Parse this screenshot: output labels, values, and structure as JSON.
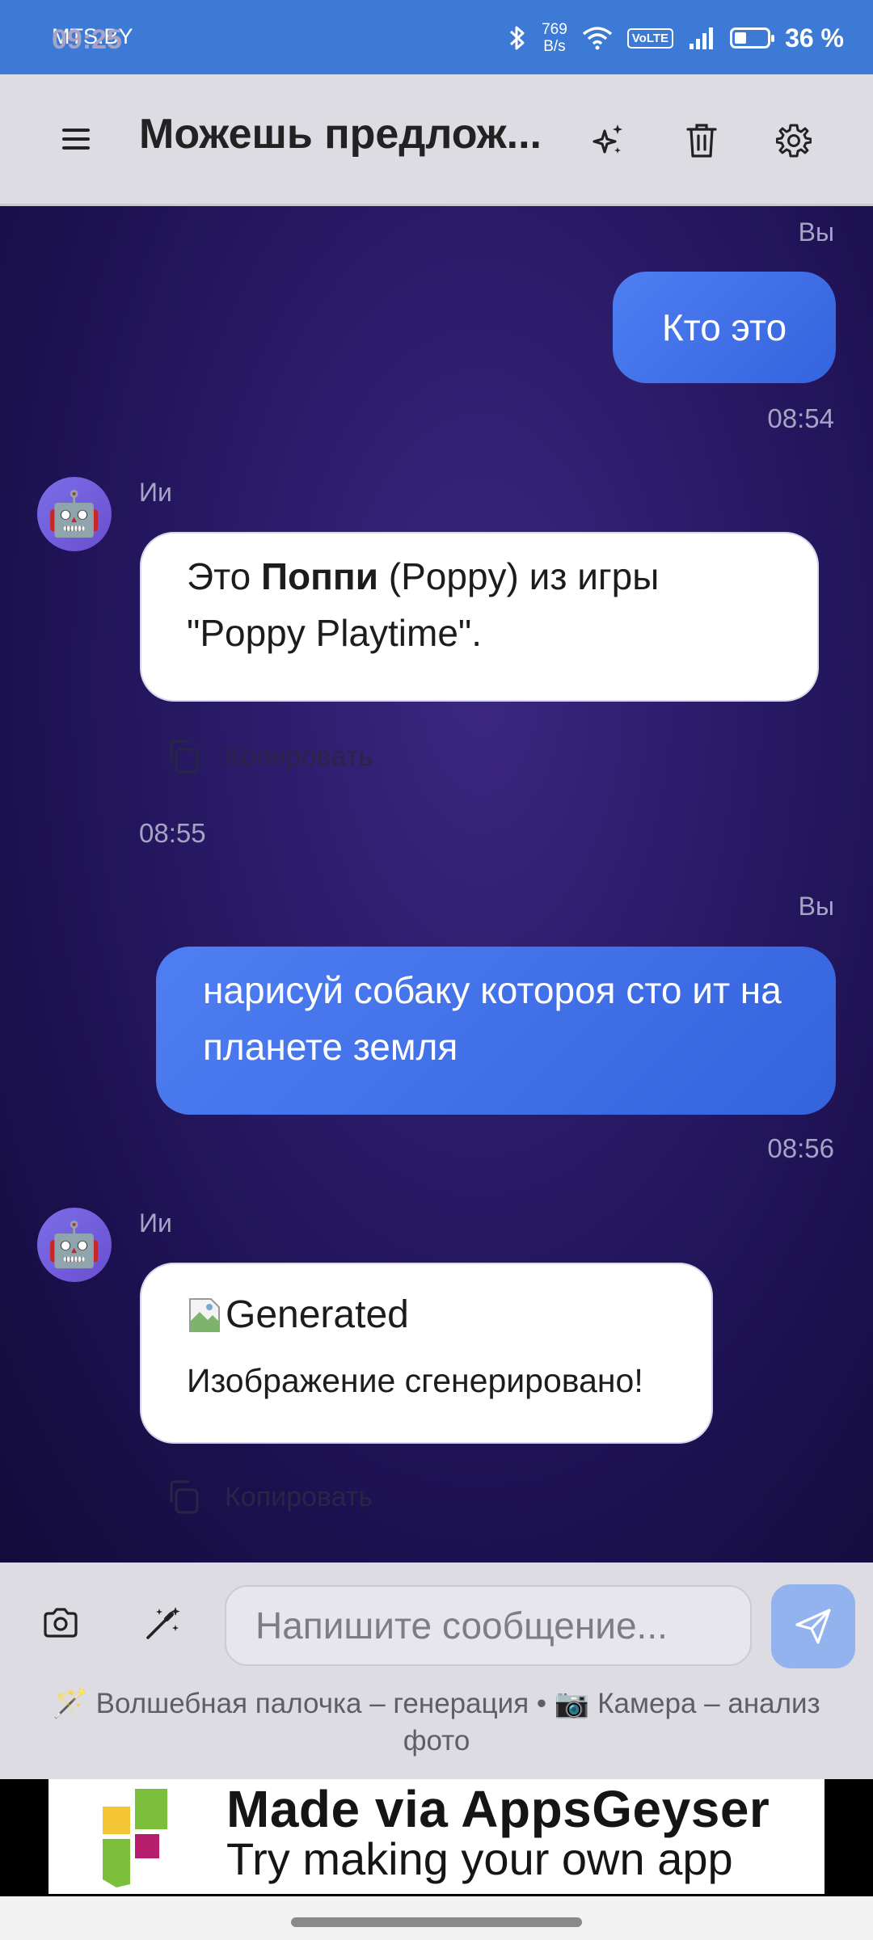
{
  "status_bar": {
    "carrier": "MTS.BY",
    "time": "09:25",
    "net_speed_value": "769",
    "net_speed_unit": "B/s",
    "volte": "VoLTE",
    "battery_text": "36 %",
    "battery_level": 0.36
  },
  "app_bar": {
    "title": "Можешь предлож..."
  },
  "messages": [
    {
      "role": "user",
      "sender": "Вы",
      "text": "Кто это",
      "time": "08:54"
    },
    {
      "role": "ai",
      "sender": "Ии",
      "text_pre": "Это ",
      "text_bold": "Поппи",
      "text_post": " (Poppy) из игры \"Poppy Playtime\".",
      "copy_label": "Копировать",
      "time": "08:55"
    },
    {
      "role": "user",
      "sender": "Вы",
      "text": "нарисуй собаку котороя сто ит на планете земля",
      "time": "08:56"
    },
    {
      "role": "ai",
      "sender": "Ии",
      "image_alt": "Generated",
      "text": "Изображение сгенерировано!",
      "copy_label": "Копировать"
    }
  ],
  "composer": {
    "placeholder": "Напишите сообщение...",
    "hint": "🪄 Волшебная палочка – генерация • 📷 Камера – анализ фото"
  },
  "banner": {
    "line1": "Made via AppsGeyser",
    "line2": "Try making your own app"
  },
  "colors": {
    "status_bar": "#3d7ad6",
    "user_bubble": "#3f6fe8",
    "send_button": "#93b3ef",
    "avatar": "#7b6ee8"
  }
}
